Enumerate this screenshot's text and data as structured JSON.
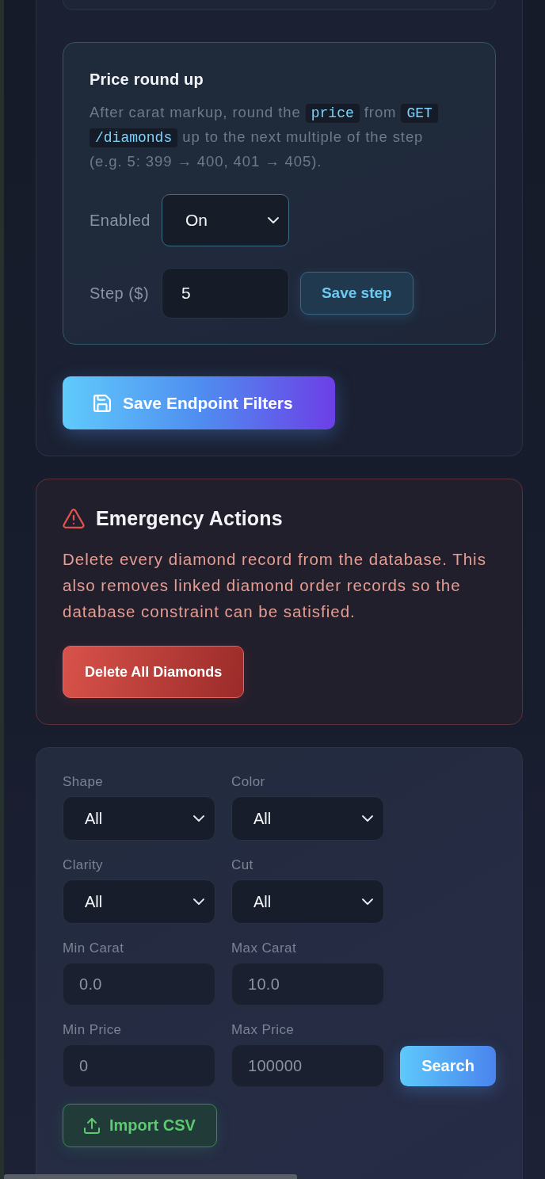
{
  "price_round_up": {
    "title": "Price round up",
    "description": [
      {
        "kind": "text",
        "text": "After carat markup, round the "
      },
      {
        "kind": "code",
        "text": "price"
      },
      {
        "kind": "text",
        "text": " from "
      },
      {
        "kind": "code",
        "text": "GET /diamonds"
      },
      {
        "kind": "text",
        "text": " up to the next multiple of the step (e.g. 5: 399 → 400, 401 → 405)."
      }
    ],
    "enabled": {
      "label": "Enabled",
      "value": "On"
    },
    "step": {
      "label": "Step ($)",
      "value": "5",
      "button": "Save step"
    }
  },
  "save_button": {
    "label": "Save Endpoint Filters"
  },
  "emergency": {
    "title": "Emergency Actions",
    "description": "Delete every diamond record from the database. This also removes linked diamond order records so the database constraint can be satisfied.",
    "button": "Delete All Diamonds"
  },
  "filters": {
    "fields": [
      {
        "kind": "select",
        "label": "Shape",
        "value": "All"
      },
      {
        "kind": "select",
        "label": "Color",
        "value": "All"
      },
      {
        "kind": "select",
        "label": "Clarity",
        "value": "All"
      },
      {
        "kind": "select",
        "label": "Cut",
        "value": "All"
      },
      {
        "kind": "input",
        "label": "Min Carat",
        "placeholder": "0.0"
      },
      {
        "kind": "input",
        "label": "Max Carat",
        "placeholder": "10.0"
      },
      {
        "kind": "input",
        "label": "Min Price",
        "placeholder": "0"
      },
      {
        "kind": "input",
        "label": "Max Price",
        "placeholder": "100000"
      }
    ],
    "search_button": "Search",
    "import_button": "Import CSV"
  }
}
